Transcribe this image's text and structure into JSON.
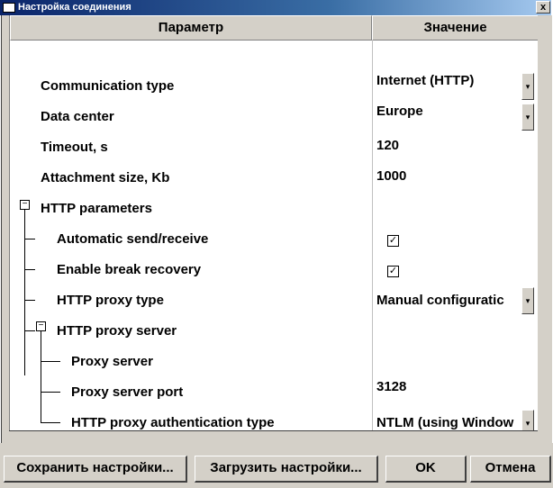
{
  "window": {
    "title": "Настройка соединения",
    "close_label": "x"
  },
  "grid": {
    "headers": {
      "parameter": "Параметр",
      "value": "Значение"
    },
    "rows": {
      "communication_type": {
        "label": "Communication type",
        "value": "Internet (HTTP)"
      },
      "data_center": {
        "label": "Data center",
        "value": "Europe"
      },
      "timeout": {
        "label": "Timeout, s",
        "value": "120"
      },
      "attachment_size": {
        "label": "Attachment size, Kb",
        "value": "1000"
      },
      "http_parameters": {
        "label": "HTTP parameters"
      },
      "auto_send_receive": {
        "label": "Automatic send/receive",
        "checked": true
      },
      "break_recovery": {
        "label": "Enable break recovery",
        "checked": true
      },
      "proxy_type": {
        "label": "HTTP proxy type",
        "value": "Manual configuratic"
      },
      "proxy_server_group": {
        "label": "HTTP proxy server"
      },
      "proxy_server": {
        "label": "Proxy server",
        "value": ""
      },
      "proxy_port": {
        "label": "Proxy server port",
        "value": "3128"
      },
      "proxy_auth": {
        "label": "HTTP proxy authentication type",
        "value": "NTLM (using Window"
      }
    },
    "check_glyph": "✓",
    "collapse_glyph": "−",
    "dropdown_glyph": "▾"
  },
  "buttons": {
    "save_settings": "Сохранить настройки...",
    "load_settings": "Загрузить настройки...",
    "ok": "OK",
    "cancel": "Отмена"
  }
}
